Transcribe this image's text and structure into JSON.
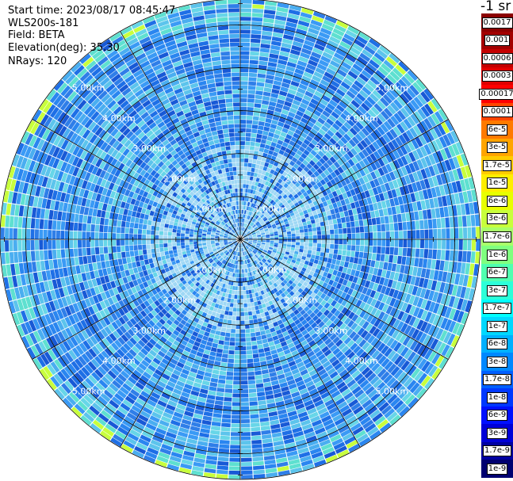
{
  "info": {
    "start_time": "Start time: 2023/08/17 08:45:47",
    "instrument": "WLS200s-181",
    "field": "Field: BETA",
    "elevation": "Elevation(deg): 35.30",
    "nrays": "NRays: 120"
  },
  "colorbar": {
    "title": "-1 sr",
    "levels": [
      "0.0017",
      "0.001",
      "0.0006",
      "0.0003",
      "0.00017",
      "0.0001",
      "6e-5",
      "3e-5",
      "1.7e-5",
      "1e-5",
      "6e-6",
      "3e-6",
      "1.7e-6",
      "1e-6",
      "6e-7",
      "3e-7",
      "1.7e-7",
      "1e-7",
      "6e-8",
      "3e-8",
      "1.7e-8",
      "1e-8",
      "6e-9",
      "3e-9",
      "1.7e-9",
      "1e-9"
    ],
    "colors": [
      "#8b0000",
      "#a30000",
      "#c40000",
      "#e00000",
      "#ff0000",
      "#ff4500",
      "#ff7a00",
      "#ffa500",
      "#ffcc00",
      "#ffee00",
      "#e8ff00",
      "#c8ff3c",
      "#a8ff6a",
      "#7fff7f",
      "#50ffb0",
      "#2cffd8",
      "#00ffff",
      "#00d8ff",
      "#00b0ff",
      "#0088ff",
      "#0060ff",
      "#0038ff",
      "#0010ff",
      "#0000d8",
      "#0000a0",
      "#000070"
    ]
  },
  "chart_data": {
    "type": "ppi",
    "title": "",
    "xlabel": "",
    "ylabel": "",
    "field": "BETA",
    "elevation_deg": 35.3,
    "n_rays": 120,
    "range_rings_km": [
      1,
      2,
      3,
      4,
      5
    ],
    "range_labels": [
      "1.00km",
      "2.00km",
      "3.00km",
      "4.00km",
      "5.00km"
    ],
    "max_range_km": 5.6,
    "radial_lines_deg": [
      0,
      30,
      60,
      90,
      120,
      150,
      180,
      210,
      240,
      270,
      300,
      330
    ],
    "grid": true
  }
}
